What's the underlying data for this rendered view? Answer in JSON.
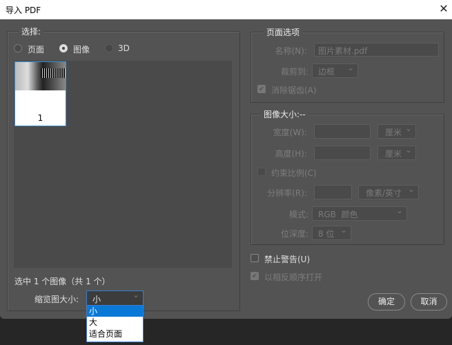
{
  "window": {
    "title": "导入 PDF",
    "close_icon": "close-icon"
  },
  "select_group": {
    "legend": "选择:",
    "radios": [
      {
        "label": "页面",
        "selected": false
      },
      {
        "label": "图像",
        "selected": true
      },
      {
        "label": "3D",
        "selected": false
      }
    ],
    "thumbnails": [
      {
        "label": "1",
        "selected": true
      }
    ],
    "status": "选中 1 个图像（共 1 个）",
    "thumb_size_label": "缩览图大小:",
    "thumb_size_value": "小",
    "thumb_size_options": [
      {
        "label": "小",
        "highlighted": true
      },
      {
        "label": "大",
        "highlighted": false
      },
      {
        "label": "适合页面",
        "highlighted": false
      }
    ]
  },
  "page_options": {
    "legend": "页面选项",
    "name_label": "名称(N):",
    "name_value": "图片素材.pdf",
    "crop_label": "裁剪到:",
    "crop_value": "边框",
    "antialias_label": "消除锯齿(A)",
    "antialias_checked": true
  },
  "image_size": {
    "legend": "图像大小:--",
    "width_label": "宽度(W):",
    "width_value": "",
    "width_unit": "厘米",
    "height_label": "高度(H):",
    "height_value": "",
    "height_unit": "厘米",
    "constrain_label": "约束比例(C)",
    "resolution_label": "分辨率(R):",
    "resolution_value": "",
    "resolution_unit": "像素/英寸",
    "mode_label": "模式:",
    "mode_value": "RGB  颜色",
    "depth_label": "位深度:",
    "depth_value": "8 位"
  },
  "suppress_warnings_label": "禁止警告(U)",
  "suppress_warnings_checked": false,
  "reverse_order_label": "以相反顺序打开",
  "reverse_order_checked": true,
  "buttons": {
    "ok": "确定",
    "cancel": "取消"
  }
}
